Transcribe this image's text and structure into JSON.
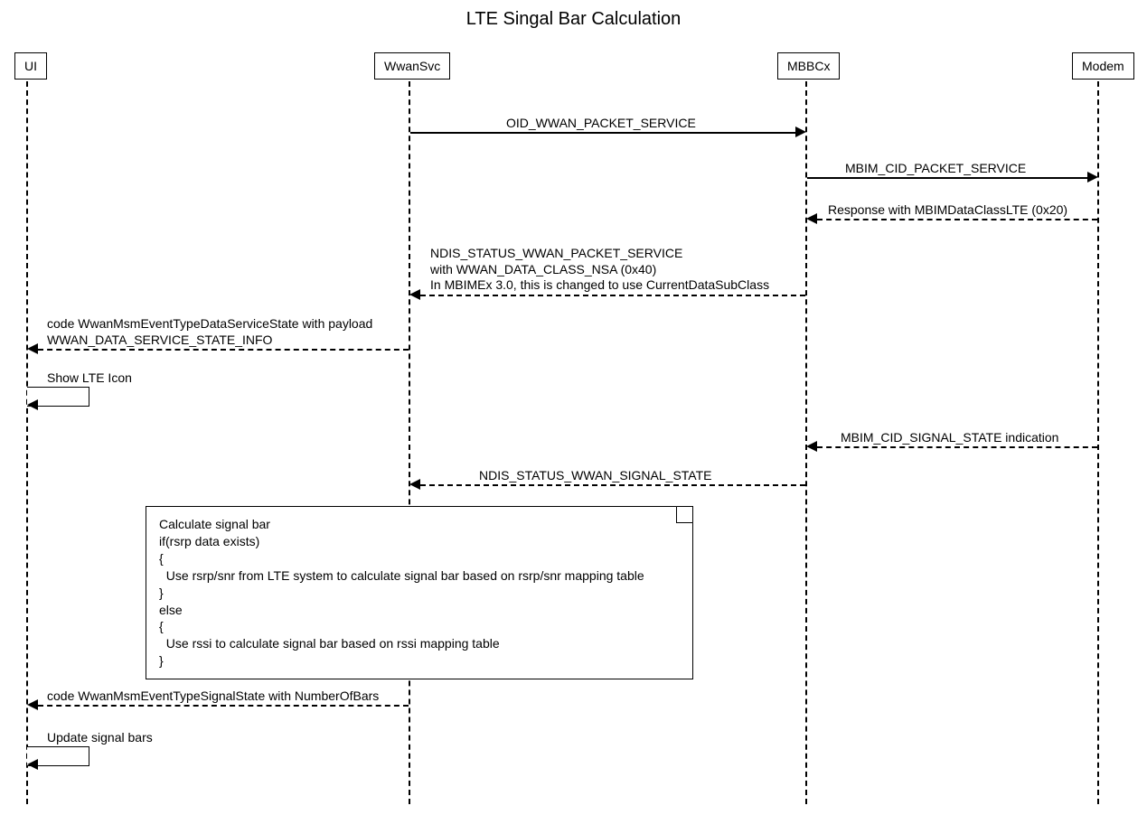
{
  "title": "LTE Singal Bar Calculation",
  "actors": {
    "ui": "UI",
    "wwansvc": "WwanSvc",
    "mbbcx": "MBBCx",
    "modem": "Modem"
  },
  "messages": {
    "m1": "OID_WWAN_PACKET_SERVICE",
    "m2": "MBIM_CID_PACKET_SERVICE",
    "m3": "Response with MBIMDataClassLTE (0x20)",
    "m4_l1": "NDIS_STATUS_WWAN_PACKET_SERVICE",
    "m4_l2": "with WWAN_DATA_CLASS_NSA (0x40)",
    "m4_l3": "In MBIMEx 3.0, this is changed to use CurrentDataSubClass",
    "m5_l1": "code WwanMsmEventTypeDataServiceState with payload",
    "m5_l2": "WWAN_DATA_SERVICE_STATE_INFO",
    "m6": "Show LTE Icon",
    "m7": "MBIM_CID_SIGNAL_STATE indication",
    "m8": "NDIS_STATUS_WWAN_SIGNAL_STATE",
    "m9": "code WwanMsmEventTypeSignalState with NumberOfBars",
    "m10": "Update signal bars"
  },
  "note": {
    "l1": "Calculate signal bar",
    "l2": "if(rsrp data exists)",
    "l3": "{",
    "l4": "  Use rsrp/snr from LTE system to calculate signal bar based on rsrp/snr mapping table",
    "l5": "}",
    "l6": "else",
    "l7": "{",
    "l8": "  Use rssi to calculate signal bar based on rssi mapping table",
    "l9": "}"
  }
}
